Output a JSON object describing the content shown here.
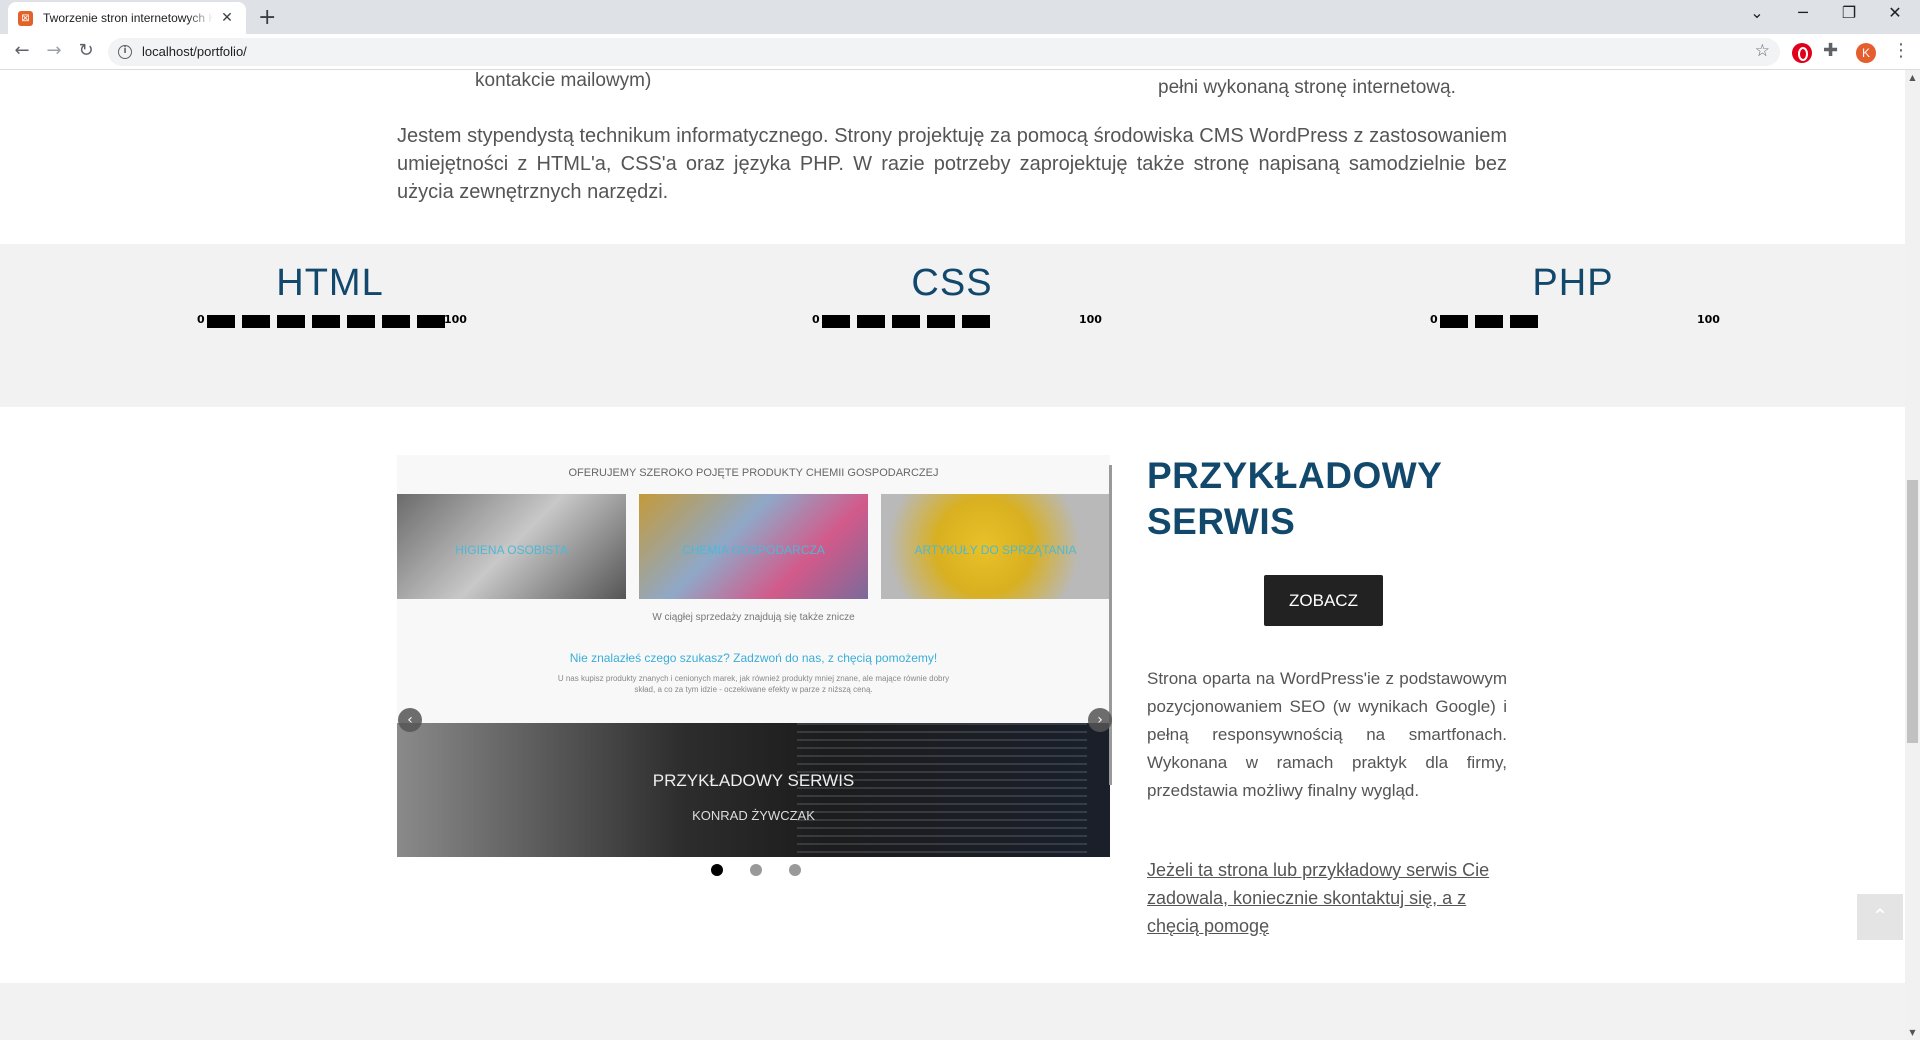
{
  "browser": {
    "tab_title": "Tworzenie stron internetowych Konrad Żywczak",
    "tab_favicon": "xampp-icon",
    "tab_close": "✕",
    "new_tab": "+",
    "url": "localhost/portfolio/",
    "avatar_letter": "K",
    "controls": {
      "minimize": "─",
      "restore": "❐",
      "close": "✕",
      "tab_search": "⌄"
    }
  },
  "top_fragments": {
    "left": "kontakcie mailowym)",
    "right": "pełni wykonaną stronę internetową."
  },
  "intro": "Jestem stypendystą technikum informatycznego. Strony projektuję za pomocą środowiska CMS WordPress z zastosowaniem umiejętności z HTML'a, CSS'a oraz języka PHP. W razie potrzeby zaprojektuję także stronę napisaną samodzielnie bez użycia zewnętrznych narzędzi.",
  "skills": [
    {
      "name": "HTML",
      "min": "0",
      "max": "100",
      "level_percent": 100
    },
    {
      "name": "CSS",
      "min": "0",
      "max": "100",
      "level_percent": 70
    },
    {
      "name": "PHP",
      "min": "0",
      "max": "100",
      "level_percent": 45
    }
  ],
  "slider": {
    "header": "OFERUJEMY SZEROKO POJĘTE PRODUKTY CHEMII GOSPODARCZEJ",
    "cards": [
      "HIGIENA OSOBISTA",
      "CHEMIA GOSPODARCZA",
      "ARTYKUŁY DO SPRZĄTANIA"
    ],
    "mid_text": "W ciągłej sprzedaży znajdują się także znicze",
    "cta": "Nie znalazłeś czego szukasz? Zadzwoń do nas, z chęcią pomożemy!",
    "small_text": "U nas kupisz produkty znanych i cenionych marek, jak również produkty mniej znane, ale mające równie dobry skład, a co za tym idzie - oczekiwane efekty w parze z niższą ceną.",
    "dark_title": "PRZYKŁADOWY SERWIS",
    "dark_sub": "KONRAD ŻYWCZAK",
    "prev": "‹",
    "next": "›",
    "dots": 3,
    "active_dot": 1
  },
  "service": {
    "title_line1": "PRZYKŁADOWY",
    "title_line2": "SERWIS",
    "button": "ZOBACZ",
    "description": "Strona oparta na WordPress'ie z podstawowym pozycjonowaniem SEO (w wynikach Google) i pełną responsywnością na smartfonach. Wykonana w ramach praktyk dla firmy, przedstawia możliwy finalny wygląd.",
    "contact_link": "Jeżeli ta strona lub przykładowy serwis Cie zadowala, koniecznie skontaktuj się, a z chęcią pomogę"
  },
  "to_top": "⌃"
}
